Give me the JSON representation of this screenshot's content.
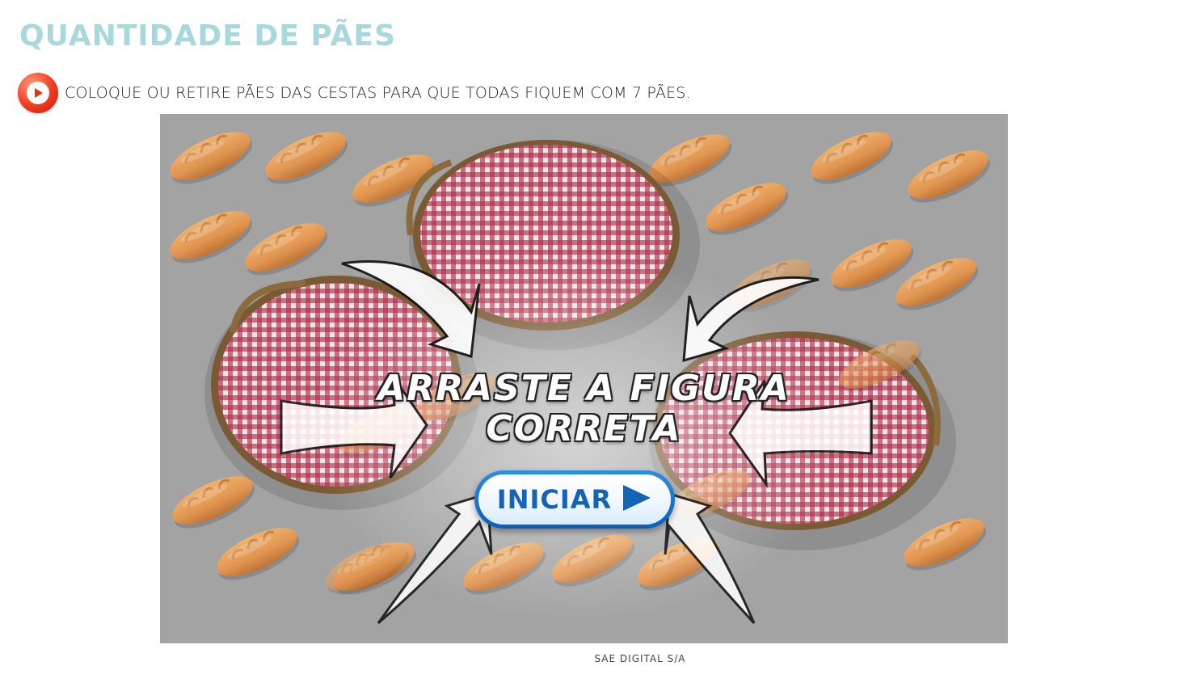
{
  "page": {
    "title": "QUANTIDADE DE PÃES",
    "instruction": "COLOQUE OU RETIRE PÃES DAS CESTAS PARA QUE TODAS FIQUEM COM 7 PÃES.",
    "audio_icon": "play-icon",
    "footer": "SAE DIGITAL S/A"
  },
  "game": {
    "cta_line1": "ARRASTE A FIGURA",
    "cta_line2": "CORRETA",
    "start_label": "INICIAR",
    "start_icon": "play-triangle-icon",
    "basket_count": 3,
    "bread_count": 28
  },
  "colors": {
    "title": "#a8d8dc",
    "audio_button": "#ee3a1f",
    "game_background": "#a3a3a3",
    "bread": "#e39a52",
    "basket_cloth": "#a8203a",
    "start_button": "#1563b5"
  }
}
